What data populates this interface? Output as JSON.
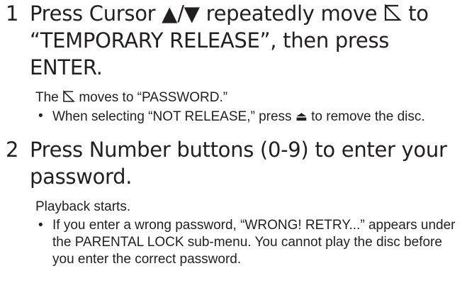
{
  "steps": [
    {
      "number": "1",
      "heading": {
        "part1": "Press Cursor ▲/▼ repeatedly move",
        "part2": "to “TEMPORARY RELEASE”, then press ENTER."
      },
      "body_intro": {
        "part1": "The",
        "part2": "moves to “PASSWORD.”"
      },
      "bullets": [
        {
          "part1": "When selecting “NOT RELEASE,” press",
          "part2": "to remove the disc."
        }
      ]
    },
    {
      "number": "2",
      "heading": {
        "text": "Press Number buttons (0-9) to enter your password."
      },
      "body_intro": {
        "text": "Playback starts."
      },
      "bullets": [
        {
          "text": "If you enter a wrong password, “WRONG! RETRY...” appears under the PARENTAL LOCK sub-menu. You cannot play the disc before you enter the correct password."
        }
      ]
    }
  ],
  "icons": {
    "cursor": "cursor-arrow-icon",
    "eject": "eject-icon",
    "eject_glyph": "⏏",
    "bullet_glyph": "•"
  }
}
